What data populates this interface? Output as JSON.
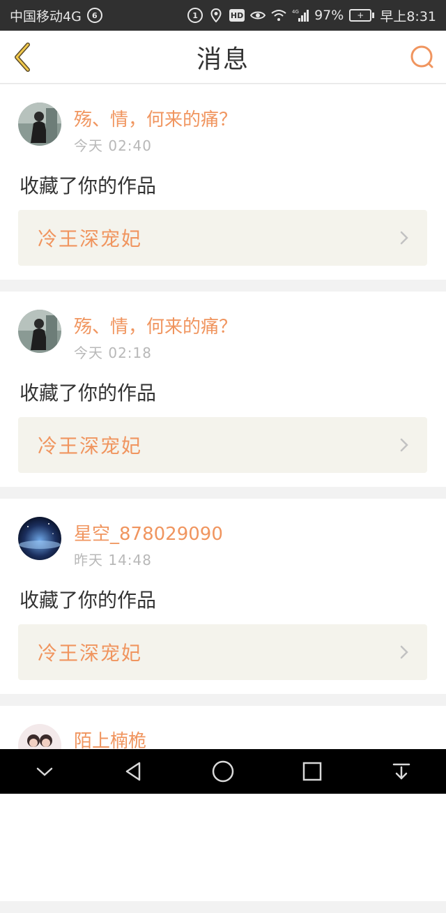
{
  "status_bar": {
    "carrier": "中国移动4G",
    "battery": "97%",
    "time": "早上8:31",
    "network": "4G",
    "icons": [
      "data-saver-icon",
      "location-icon",
      "hd-icon",
      "eye-icon",
      "wifi-icon",
      "signal-icon",
      "battery-icon"
    ]
  },
  "header": {
    "title": "消息",
    "back_icon": "chevron-left-icon",
    "search_icon": "search-icon",
    "accent": "#f0955f"
  },
  "messages": [
    {
      "username": "殇、情，何来的痛？",
      "time": "今天 02:40",
      "action": "收藏了你的作品",
      "work_title": "冷王深宠妃",
      "avatar": "avatar-person-dark"
    },
    {
      "username": "殇、情，何来的痛？",
      "time": "今天 02:18",
      "action": "收藏了你的作品",
      "work_title": "冷王深宠妃",
      "avatar": "avatar-person-dark"
    },
    {
      "username": "星空_878029090",
      "time": "昨天 14:48",
      "action": "收藏了你的作品",
      "work_title": "冷王深宠妃",
      "avatar": "avatar-night-sky"
    },
    {
      "username": "陌上楠桅",
      "time": "",
      "action": "",
      "work_title": "",
      "avatar": "avatar-couple"
    }
  ],
  "system_nav": {
    "icons": [
      "collapse-icon",
      "back-triangle-icon",
      "home-circle-icon",
      "recents-square-icon",
      "notification-pull-icon"
    ]
  }
}
